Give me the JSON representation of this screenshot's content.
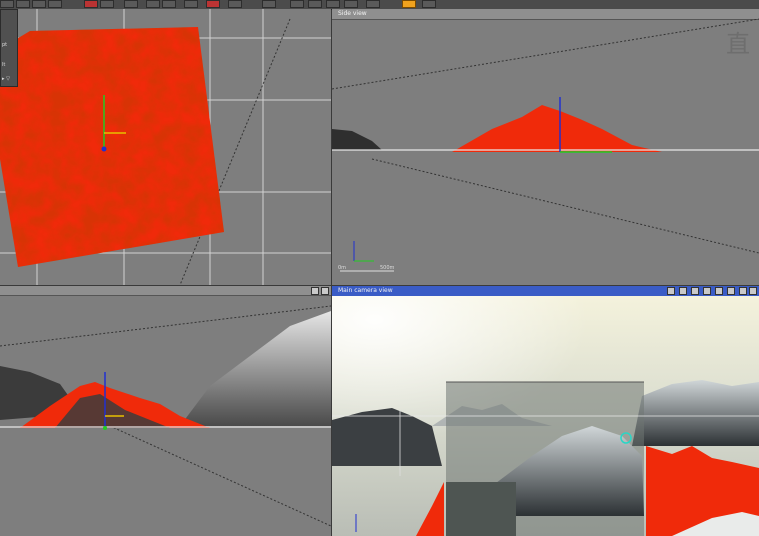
{
  "toolbar": {
    "buttons": [
      "select-icon",
      "move-icon",
      "rotate-icon",
      "scale-icon",
      "render-icon",
      "camera-icon",
      "light-icon",
      "terrain-icon",
      "sky-icon",
      "cloud-icon",
      "water-icon",
      "material-icon",
      "object-icon",
      "zoom-in-icon",
      "zoom-out-icon",
      "pan-icon",
      "view-icon",
      "layout-icon",
      "active-toggle-icon",
      "settings-icon"
    ]
  },
  "viewports": {
    "top_left": {
      "title": ""
    },
    "top_right": {
      "title": "Side view"
    },
    "bottom_left": {
      "title": ""
    },
    "bottom_right": {
      "title": "Main camera view"
    }
  },
  "side_panel": {
    "rows": [
      "pt",
      "lt",
      "▸ ▽"
    ]
  },
  "seal_text": "直",
  "scale": {
    "left": "0m",
    "right": "500m"
  },
  "colors": {
    "terrain_highlight": "#f02a0a",
    "viewport_bg": "#7e7e7e",
    "active_border": "#2e5bd6",
    "grid": "#e8e8e8"
  }
}
